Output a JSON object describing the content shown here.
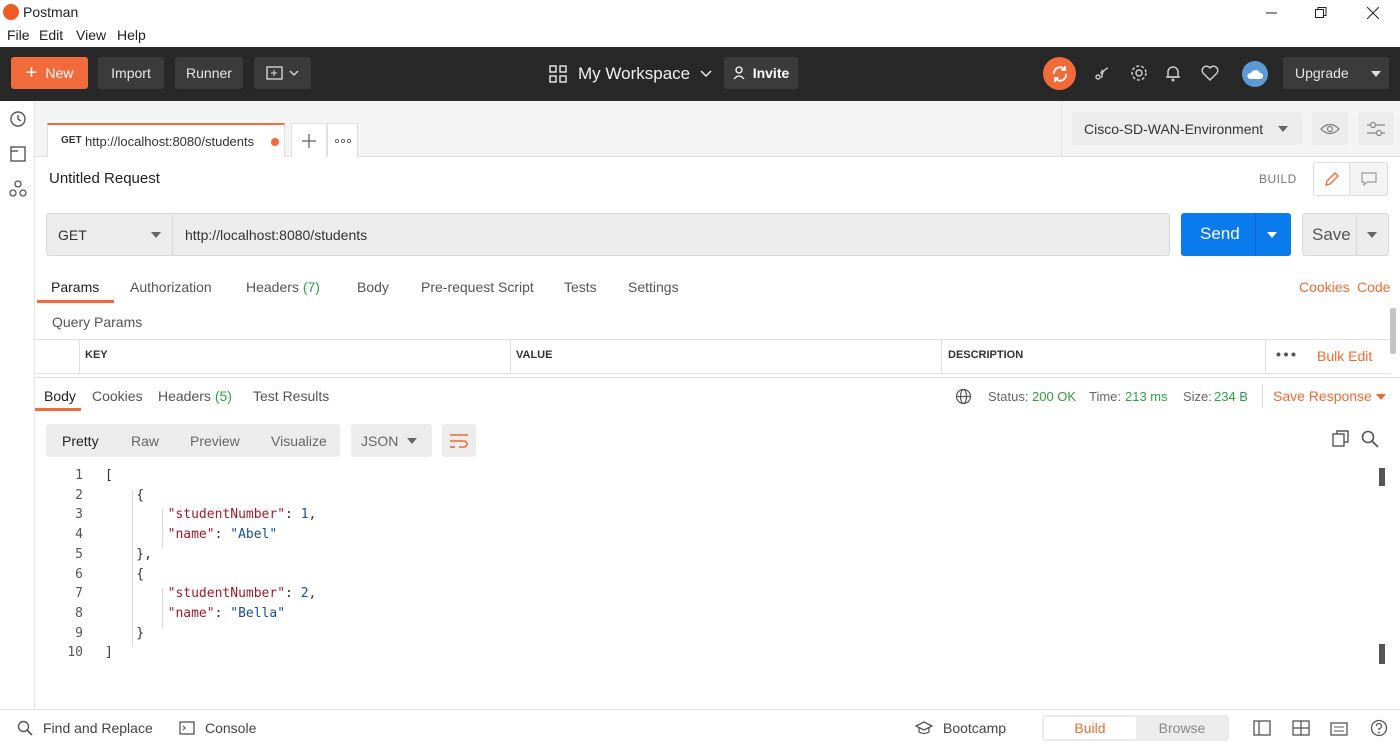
{
  "window": {
    "title": "Postman"
  },
  "menu": [
    "File",
    "Edit",
    "View",
    "Help"
  ],
  "header": {
    "new_label": "New",
    "import_label": "Import",
    "runner_label": "Runner",
    "workspace_label": "My Workspace",
    "invite_label": "Invite",
    "upgrade_label": "Upgrade"
  },
  "tab": {
    "method": "GET",
    "url": "http://localhost:8080/students"
  },
  "environment": {
    "selected": "Cisco-SD-WAN-Environment"
  },
  "request": {
    "title": "Untitled Request",
    "mode_label": "BUILD",
    "method": "GET",
    "url": "http://localhost:8080/students",
    "send_label": "Send",
    "save_label": "Save"
  },
  "request_tabs": {
    "params": "Params",
    "authorization": "Authorization",
    "headers": "Headers",
    "headers_count": "(7)",
    "body": "Body",
    "prerequest": "Pre-request Script",
    "tests": "Tests",
    "settings": "Settings",
    "cookies": "Cookies",
    "code": "Code"
  },
  "query_params": {
    "title": "Query Params",
    "columns": [
      "KEY",
      "VALUE",
      "DESCRIPTION"
    ],
    "bulk_edit": "Bulk Edit"
  },
  "response_tabs": {
    "body": "Body",
    "cookies": "Cookies",
    "headers": "Headers",
    "headers_count": "(5)",
    "test_results": "Test Results"
  },
  "response_meta": {
    "status_label": "Status:",
    "status_value": "200 OK",
    "time_label": "Time:",
    "time_value": "213 ms",
    "size_label": "Size:",
    "size_value": "234 B",
    "save_response": "Save Response"
  },
  "view_modes": {
    "pretty": "Pretty",
    "raw": "Raw",
    "preview": "Preview",
    "visualize": "Visualize",
    "format": "JSON"
  },
  "code_lines": [
    {
      "n": "1",
      "t": "["
    },
    {
      "n": "2",
      "t": "    {"
    },
    {
      "n": "3",
      "k": "\"studentNumber\"",
      "v": "1",
      "s": ","
    },
    {
      "n": "4",
      "k": "\"name\"",
      "v": "\"Abel\"",
      "s": ""
    },
    {
      "n": "5",
      "t": "    },"
    },
    {
      "n": "6",
      "t": "    {"
    },
    {
      "n": "7",
      "k": "\"studentNumber\"",
      "v": "2",
      "s": ","
    },
    {
      "n": "8",
      "k": "\"name\"",
      "v": "\"Bella\"",
      "s": ""
    },
    {
      "n": "9",
      "t": "    }"
    },
    {
      "n": "10",
      "t": "]"
    }
  ],
  "footer": {
    "find_replace": "Find and Replace",
    "console": "Console",
    "bootcamp": "Bootcamp",
    "build": "Build",
    "browse": "Browse"
  },
  "colors": {
    "accent": "#f26b3a",
    "send": "#097bed",
    "status_green": "#2f9e44",
    "header_bg": "#282828"
  }
}
